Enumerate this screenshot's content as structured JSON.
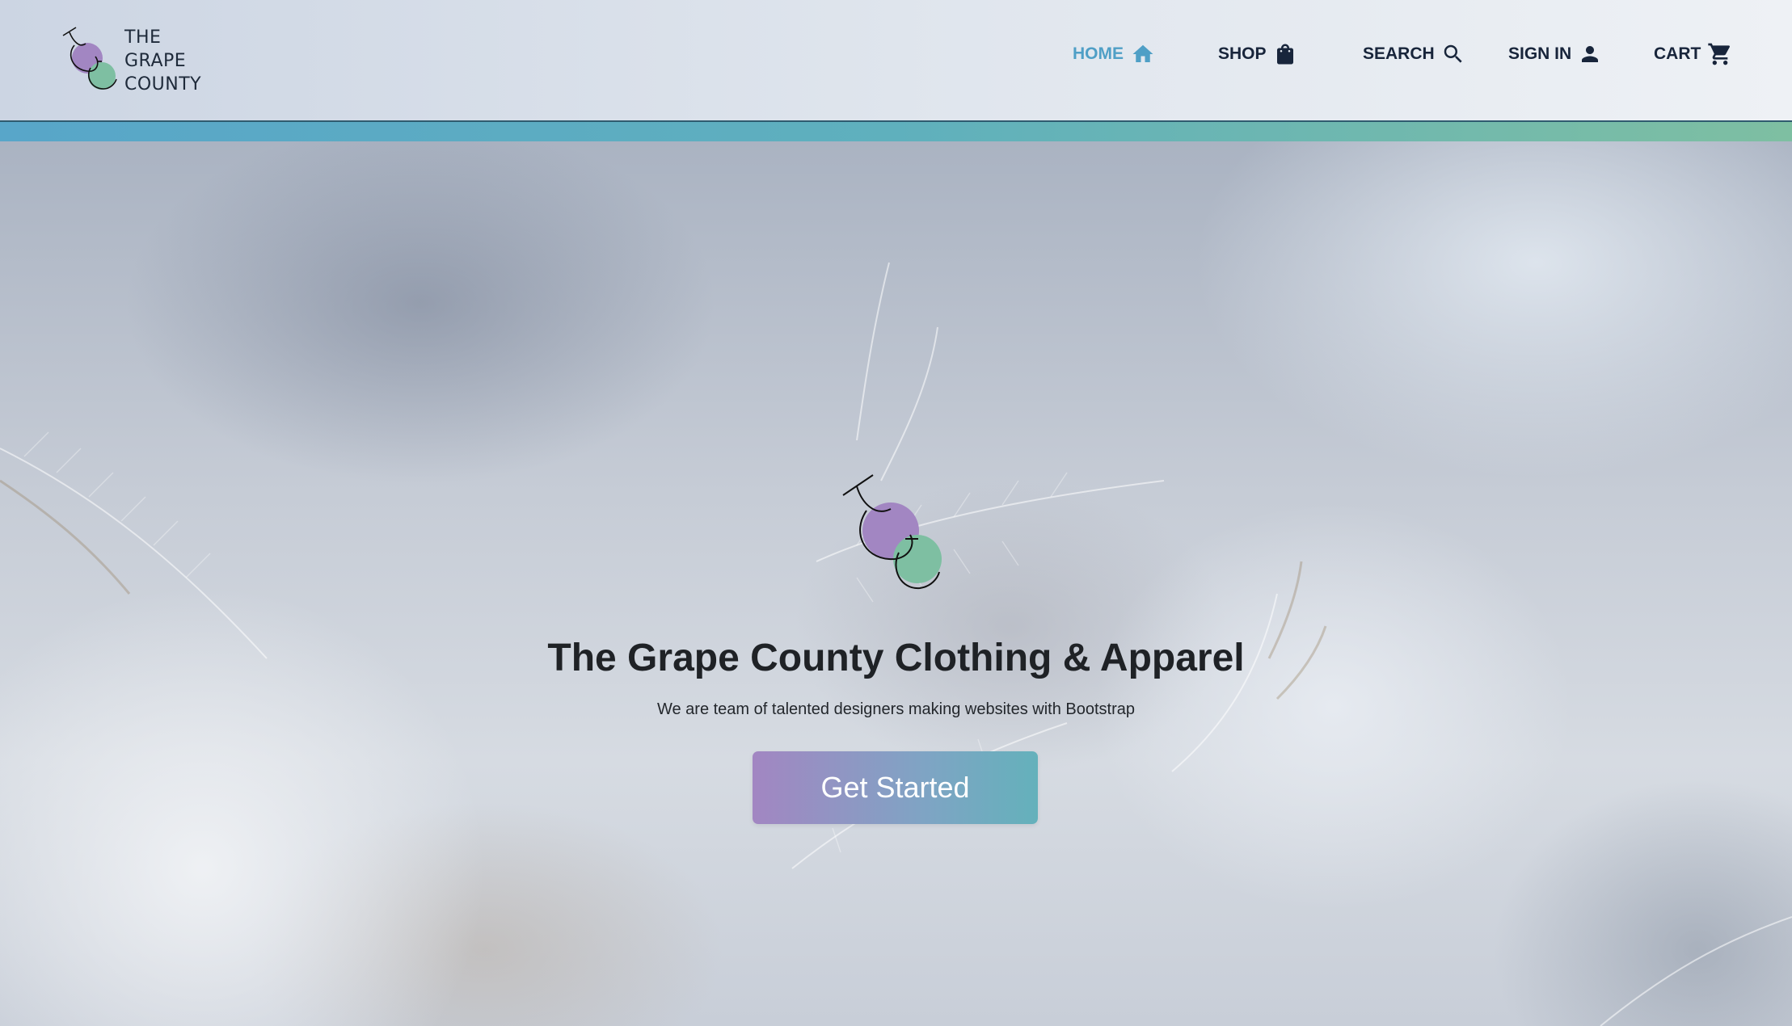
{
  "brand": {
    "logo_lines": [
      "THE",
      "GRAPE",
      "COUNTY"
    ],
    "colors": {
      "grape": "#a286c2",
      "leaf": "#7ebfa2",
      "accent": "#4f9fc6",
      "ink": "#18253b"
    }
  },
  "nav": {
    "items": [
      {
        "label": "HOME",
        "icon": "home-icon",
        "active": true
      },
      {
        "label": "SHOP",
        "icon": "shopping-bag-icon",
        "active": false
      },
      {
        "label": "SEARCH",
        "icon": "search-icon",
        "active": false
      },
      {
        "label": "SIGN IN",
        "icon": "user-icon",
        "active": false
      },
      {
        "label": "CART",
        "icon": "cart-icon",
        "active": false
      }
    ]
  },
  "hero": {
    "title": "The Grape County Clothing & Apparel",
    "subtitle": "We are team of talented designers making websites with Bootstrap",
    "cta_label": "Get Started",
    "cta_gradient": [
      "#a286c2",
      "#64b1bb"
    ]
  }
}
